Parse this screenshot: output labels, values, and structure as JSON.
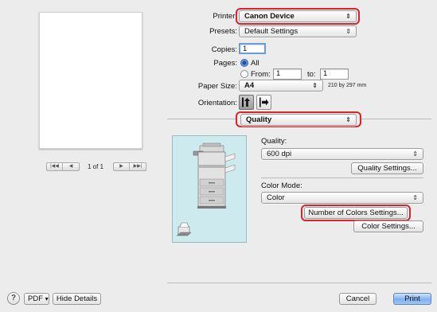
{
  "preview": {
    "page_counter": "1 of 1",
    "nav": [
      "first-page",
      "previous-page",
      "next-page",
      "last-page"
    ]
  },
  "printer": {
    "label": "Printer:",
    "value": "Canon Device"
  },
  "presets": {
    "label": "Presets:",
    "value": "Default Settings"
  },
  "copies": {
    "label": "Copies:",
    "value": "1"
  },
  "pages": {
    "label": "Pages:",
    "all_label": "All",
    "from_label": "From:",
    "from_value": "1",
    "to_label": "to:",
    "to_value": "1",
    "selected": "All"
  },
  "paper_size": {
    "label": "Paper Size:",
    "value": "A4",
    "dimensions": "210 by 297 mm"
  },
  "orientation": {
    "label": "Orientation:",
    "selected": "portrait"
  },
  "panel_selector": {
    "value": "Quality"
  },
  "quality": {
    "label": "Quality:",
    "value": "600 dpi",
    "settings_button": "Quality Settings..."
  },
  "color_mode": {
    "label": "Color Mode:",
    "value": "Color",
    "number_of_colors_button": "Number of Colors Settings...",
    "color_settings_button": "Color Settings..."
  },
  "footer": {
    "help": "?",
    "pdf": "PDF",
    "hide_details": "Hide Details",
    "cancel": "Cancel",
    "print": "Print"
  },
  "colors": {
    "highlight": "#d9242a",
    "illustration_bg": "#cdebee",
    "print_button": "#7fb1ee"
  },
  "icons": {
    "popup_arrows": "⌃⌄",
    "pdf_arrow": "▾",
    "first": "|◀◀",
    "prev": "◀",
    "next": "▶",
    "last": "▶▶|"
  }
}
